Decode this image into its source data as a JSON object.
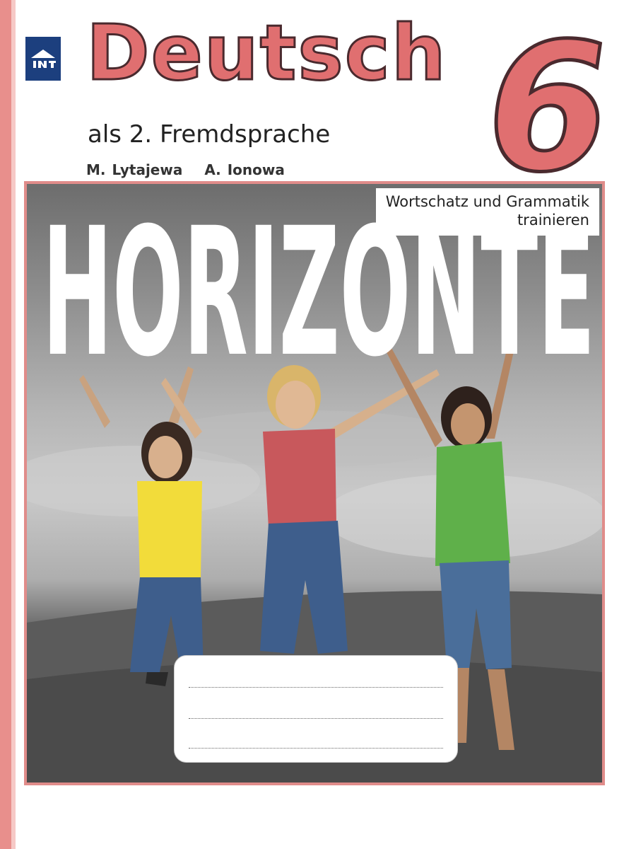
{
  "cover": {
    "title": "Deutsch",
    "grade": "6",
    "subtitle": "als 2. Fremdsprache",
    "authors": [
      "M. Lytajewa",
      "A. Ionowa"
    ],
    "series_name": "HORIZONTE",
    "series_subtitle_line1": "Wortschatz und Grammatik",
    "series_subtitle_line2": "trainieren",
    "publisher_logo": "prosveshchenie-publisher-logo",
    "name_field_lines": 3
  },
  "colors": {
    "accent": "#e06f70",
    "frame": "#e08c8a",
    "logo_blue": "#1c3f7e",
    "shirt_yellow": "#f2dc3a",
    "shirt_red": "#c8585c",
    "shirt_green": "#5fb04a",
    "jeans_blue": "#3e5e8c"
  }
}
